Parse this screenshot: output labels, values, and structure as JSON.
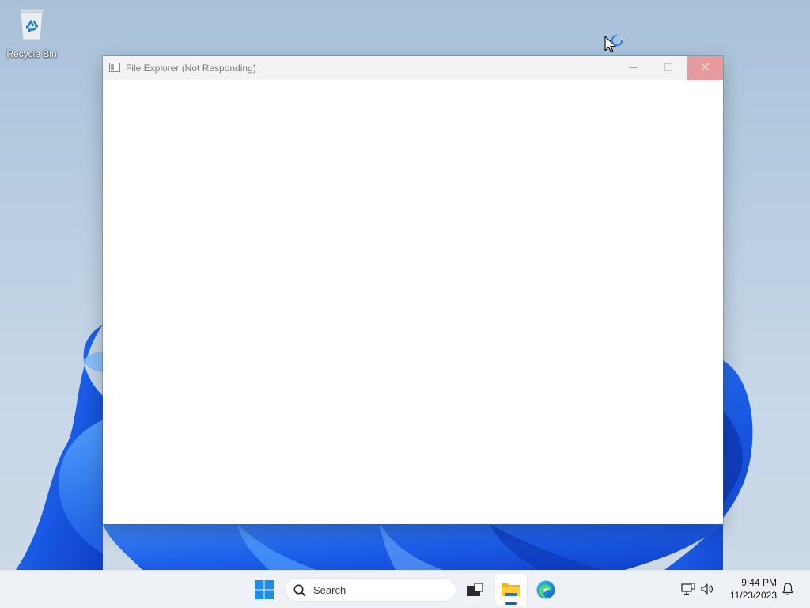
{
  "desktop": {
    "recycle_bin_label": "Recycle Bin"
  },
  "window": {
    "title": "File Explorer (Not Responding)",
    "app_icon": "window-app-icon",
    "controls": [
      "minimize-icon",
      "maximize-icon",
      "close-icon"
    ]
  },
  "taskbar": {
    "start_icon": "windows-logo-icon",
    "search_placeholder": "Search",
    "items": [
      {
        "name": "task-view",
        "icon": "task-view-icon"
      },
      {
        "name": "file-explorer",
        "icon": "folder-icon",
        "active": true
      },
      {
        "name": "edge",
        "icon": "edge-icon"
      }
    ],
    "tray": {
      "network_icon": "network-icon",
      "volume_icon": "volume-icon",
      "time": "9:44 PM",
      "date": "11/23/2023",
      "notification_icon": "bell-icon"
    }
  },
  "colors": {
    "accent": "#0067c0",
    "close_hover": "#e69a9e",
    "bloom_blue": "#1a56e0"
  }
}
